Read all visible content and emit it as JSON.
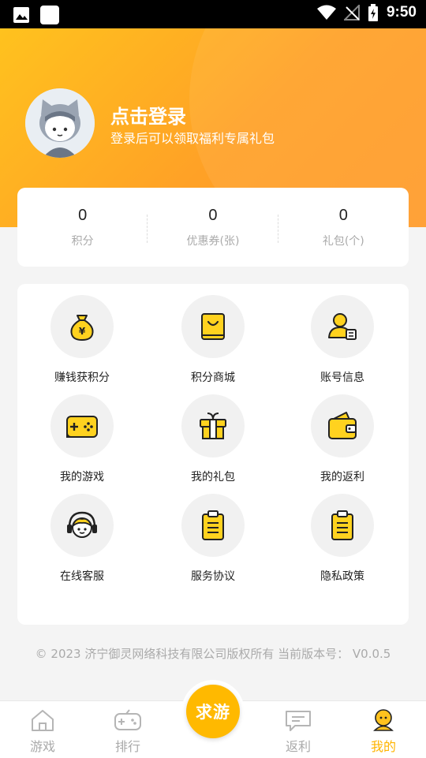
{
  "status_bar": {
    "time": "9:50"
  },
  "profile": {
    "title": "点击登录",
    "subtitle": "登录后可以领取福利专属礼包"
  },
  "stats": [
    {
      "value": "0",
      "label": "积分"
    },
    {
      "value": "0",
      "label": "优惠券(张)"
    },
    {
      "value": "0",
      "label": "礼包(个)"
    }
  ],
  "menu": [
    {
      "label": "赚钱获积分",
      "icon": "money-bag-icon"
    },
    {
      "label": "积分商城",
      "icon": "shopping-bag-icon"
    },
    {
      "label": "账号信息",
      "icon": "account-card-icon"
    },
    {
      "label": "我的游戏",
      "icon": "gamepad-icon"
    },
    {
      "label": "我的礼包",
      "icon": "gift-icon"
    },
    {
      "label": "我的返利",
      "icon": "wallet-icon"
    },
    {
      "label": "在线客服",
      "icon": "headset-icon"
    },
    {
      "label": "服务协议",
      "icon": "clipboard-icon"
    },
    {
      "label": "隐私政策",
      "icon": "clipboard-icon"
    }
  ],
  "footer": {
    "copyright": "© 2023 济宁御灵网络科技有限公司版权所有 当前版本号： V0.0.5"
  },
  "tabs": [
    {
      "label": "游戏",
      "icon": "home-icon"
    },
    {
      "label": "排行",
      "icon": "gamepad-outline-icon"
    },
    {
      "label": "返利",
      "icon": "message-icon"
    },
    {
      "label": "我的",
      "icon": "user-icon"
    }
  ],
  "center_button": {
    "label": "求游"
  },
  "colors": {
    "accent": "#ffb400",
    "hero_start": "#ffc21e",
    "hero_end": "#ff9a29",
    "icon_yellow": "#ffd21f"
  }
}
